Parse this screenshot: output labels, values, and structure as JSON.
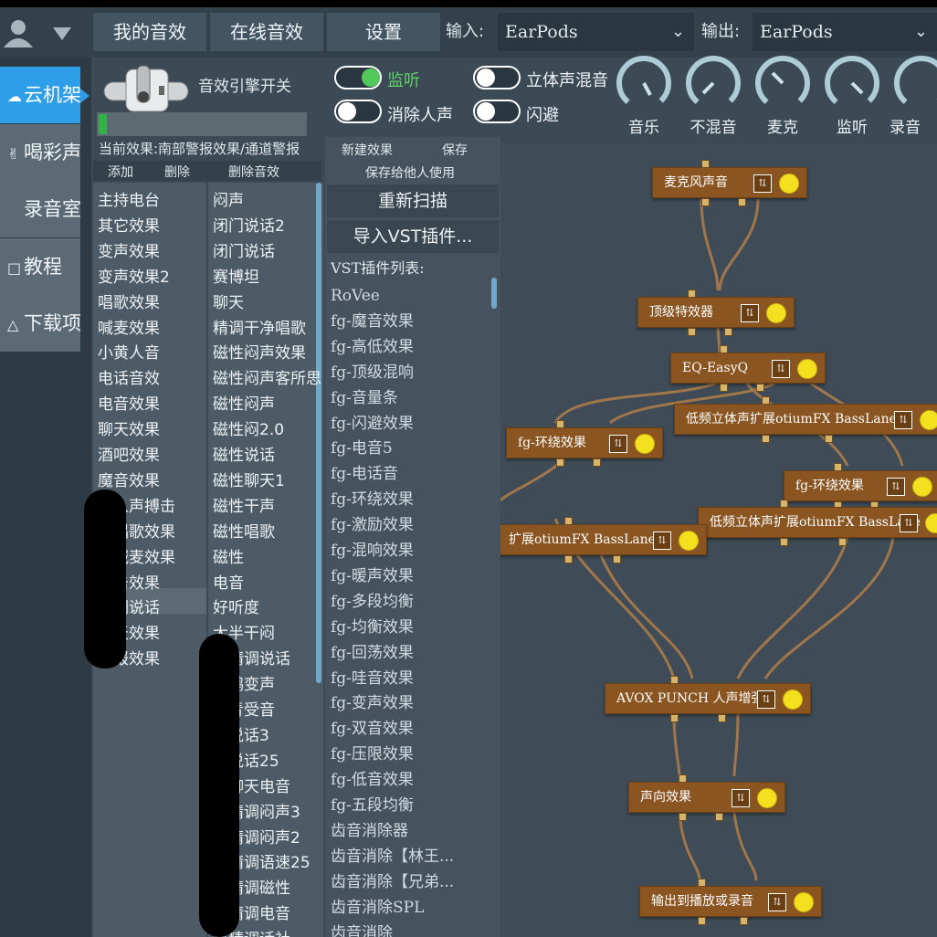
{
  "topbar": {
    "tabs": [
      "我的音效",
      "在线音效",
      "设置"
    ],
    "input_label": "输入:",
    "input_device": "EarPods",
    "output_label": "输出:",
    "output_device": "EarPods"
  },
  "sidebar": {
    "items": [
      "云机架",
      "喝彩声",
      "录音室",
      "教程",
      "下载项"
    ],
    "active_index": 0
  },
  "engine": {
    "switch_label": "音效引擎开关",
    "level_fraction": 0.04
  },
  "toggles": [
    {
      "label": "监听",
      "on": true
    },
    {
      "label": "立体声混音",
      "on": false
    },
    {
      "label": "消除人声",
      "on": false
    },
    {
      "label": "闪避",
      "on": false
    }
  ],
  "knobs": [
    "音乐",
    "不混音",
    "麦克",
    "监听",
    "录音"
  ],
  "effects": {
    "current_label": "当前效果:南部警报效果/通道警报",
    "buttons": [
      "添加",
      "删除",
      "删除音效"
    ],
    "col1": [
      "主持电台",
      "其它效果",
      "变声效果",
      "变声效果2",
      "唱歌效果",
      "喊麦效果",
      "小黄人音",
      "电话音效",
      "电音效果",
      "聊天效果",
      "酒吧效果",
      "魔音效果",
      "部人声搏击",
      "部唱歌效果",
      "部喊麦效果",
      "搏击效果",
      "精调说话",
      "聊天效果",
      "警报效果"
    ],
    "col2": [
      "闷声",
      "闭门说话2",
      "闭门说话",
      "赛博坦",
      "聊天",
      "精调干净唱歌",
      "磁性闷声效果",
      "磁性闷声客所思",
      "磁性闷声",
      "磁性闷2.0",
      "磁性说话",
      "磁性聊天1",
      "磁性干声",
      "磁性唱歌",
      "磁性",
      "电音",
      "好听度",
      "大半干闷",
      "音精调说话",
      "老鸭变声",
      "部青受音",
      "部说话3",
      "部说话25",
      "部聊天电音",
      "部精调闷声3",
      "部精调闷声2",
      "部精调语速25",
      "部精调磁性",
      "部精调电音",
      "部精调话社"
    ]
  },
  "vst": {
    "new_label": "新建效果",
    "save_label": "保存",
    "share_label": "保存给他人使用",
    "rescan_label": "重新扫描",
    "import_label": "导入VST插件...",
    "list_title": "VST插件列表:",
    "plugins": [
      "RoVee",
      "fg-魔音效果",
      "fg-高低效果",
      "fg-顶级混响",
      "fg-音量条",
      "fg-闪避效果",
      "fg-电音5",
      "fg-电话音",
      "fg-环绕效果",
      "fg-激励效果",
      "fg-混响效果",
      "fg-暖声效果",
      "fg-多段均衡",
      "fg-均衡效果",
      "fg-回荡效果",
      "fg-哇音效果",
      "fg-变声效果",
      "fg-双音效果",
      "fg-压限效果",
      "fg-低音效果",
      "fg-五段均衡",
      "齿音消除器",
      "齿音消除【林王...",
      "齿音消除【兄弟...",
      "齿音消除SPL",
      "齿音消除"
    ]
  },
  "graph": {
    "nodes": [
      {
        "label": "麦克风声音"
      },
      {
        "label": "顶级特效器"
      },
      {
        "label": "EQ-EasyQ"
      },
      {
        "label": "低频立体声扩展otiumFX BassLane"
      },
      {
        "label": "fg-环绕效果"
      },
      {
        "label": "fg-环绕效果"
      },
      {
        "label": "低频立体声扩展otiumFX BassLane"
      },
      {
        "label": "扩展otiumFX BassLane"
      },
      {
        "label": "AVOX PUNCH 人声增强"
      },
      {
        "label": "声向效果"
      },
      {
        "label": "输出到播放或录音"
      }
    ],
    "node_button_icon": "sliders-icon"
  },
  "colors": {
    "accent": "#2f9ee8",
    "node": "#8a5521",
    "node_dot": "#f5e020",
    "toggle_on": "#52c95a"
  }
}
